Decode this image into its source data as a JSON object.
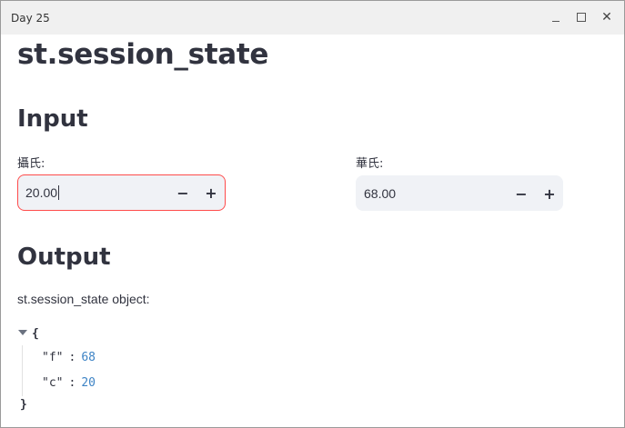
{
  "window": {
    "title": "Day 25"
  },
  "page": {
    "title": "st.session_state"
  },
  "input_section": {
    "heading": "Input",
    "celsius": {
      "label": "攝氏:",
      "value": "20.00",
      "minus": "−",
      "plus": "+"
    },
    "fahrenheit": {
      "label": "華氏:",
      "value": "68.00",
      "minus": "−",
      "plus": "+"
    }
  },
  "output_section": {
    "heading": "Output",
    "caption": "st.session_state object:",
    "json": {
      "open": "{",
      "close": "}",
      "entries": [
        {
          "key": "\"f\"",
          "value": "68"
        },
        {
          "key": "\"c\"",
          "value": "20"
        }
      ]
    }
  },
  "colors": {
    "accent_border": "#ff4b4b",
    "input_bg": "#f0f2f6",
    "json_number": "#3d83c5"
  }
}
